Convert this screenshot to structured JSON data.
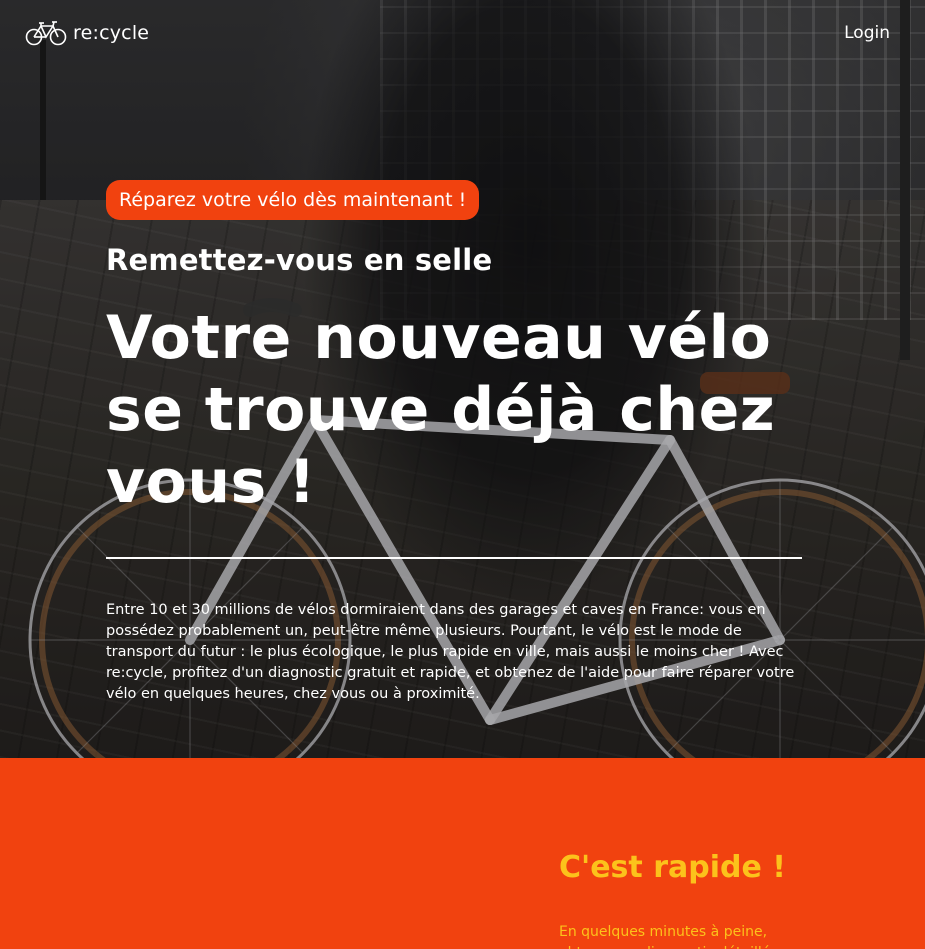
{
  "header": {
    "logo_text": "re:cycle",
    "login_label": "Login"
  },
  "hero": {
    "cta_label": "Réparez votre vélo dès maintenant !",
    "subtitle": "Remettez-vous en selle",
    "headline": "Votre nouveau vélo se trouve déjà chez vous !",
    "intro": "Entre 10 et 30 millions de vélos dormiraient dans des garages et caves en France: vous en possédez probablement un, peut-être même plusieurs. Pourtant, le vélo est le mode de transport du futur : le plus écologique, le plus rapide en ville, mais aussi le moins cher ! Avec re:cycle, profitez d'un diagnostic gratuit et rapide, et obtenez de l'aide pour faire réparer votre vélo en quelques heures, chez vous ou à proximité."
  },
  "feature": {
    "title": "C'est rapide !",
    "text": "En quelques minutes à peine, obtenez un diagnostic détaillé"
  },
  "colors": {
    "brand_orange": "#f1420f",
    "accent_yellow": "#fcc21b",
    "text_white": "#ffffff"
  },
  "icons": {
    "logo": "bicycle-icon"
  }
}
